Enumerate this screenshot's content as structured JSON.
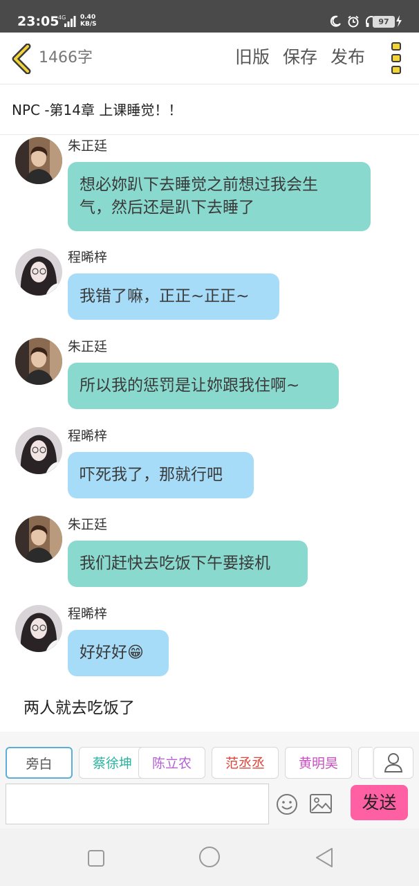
{
  "status_bar": {
    "time": "23:05",
    "network": "4G",
    "speed_value": "0.40",
    "speed_unit": "KB/S",
    "battery": "97"
  },
  "header": {
    "word_count": "1466字",
    "old_version": "旧版",
    "save": "保存",
    "publish": "发布"
  },
  "chapter_title": "NPC -第14章 上课睡觉！！",
  "messages": [
    {
      "sender": "朱正廷",
      "lines": [
        "想必妳趴下去睡觉之前想过我会生",
        "气，然后还是趴下去睡了"
      ]
    },
    {
      "sender": "程晞梓",
      "text": "我错了嘛，正正~正正~"
    },
    {
      "sender": "朱正廷",
      "text": "所以我的惩罚是让妳跟我住啊~"
    },
    {
      "sender": "程晞梓",
      "text": "吓死我了，那就行吧"
    },
    {
      "sender": "朱正廷",
      "text": "我们赶快去吃饭下午要接机"
    },
    {
      "sender": "程晞梓",
      "text": "好好好😁"
    }
  ],
  "narration": "两人就去吃饭了",
  "roles": [
    {
      "label": "旁白",
      "color": "#555555"
    },
    {
      "label": "蔡徐坤",
      "color": "#2bb3a0"
    },
    {
      "label": "陈立农",
      "color": "#b55fd6"
    },
    {
      "label": "范丞丞",
      "color": "#e0453a"
    },
    {
      "label": "黄明昊",
      "color": "#c94fc0"
    }
  ],
  "input": {
    "value": "",
    "placeholder": ""
  },
  "send_label": "发送",
  "colors": {
    "bubble_zhu": "#8ad9ce",
    "bubble_cheng": "#a6dcf8",
    "send_button": "#ff5fa3",
    "accent_yellow": "#e6c619"
  }
}
